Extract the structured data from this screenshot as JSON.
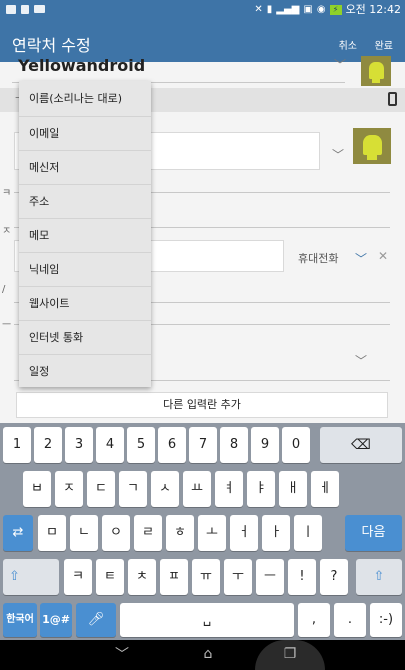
{
  "status_bar": {
    "time": "오전 12:42"
  },
  "app_bar": {
    "title": "연락처 수정",
    "cancel": "취소",
    "done": "완료"
  },
  "form": {
    "name_value": "Yellowandroid",
    "phone_type": "휴대전화",
    "add_field_button": "다른 입력란 추가"
  },
  "dropdown": {
    "items": [
      "이름(소리나는 대로)",
      "이메일",
      "메신저",
      "주소",
      "메모",
      "닉네임",
      "웹사이트",
      "인터넷 통화",
      "일정"
    ]
  },
  "keyboard": {
    "row1": [
      "1",
      "2",
      "3",
      "4",
      "5",
      "6",
      "7",
      "8",
      "9",
      "0"
    ],
    "row2": [
      "ㅂ",
      "ㅈ",
      "ㄷ",
      "ㄱ",
      "ㅅ",
      "ㅛ",
      "ㅕ",
      "ㅑ",
      "ㅐ",
      "ㅔ"
    ],
    "row3": [
      "ㅁ",
      "ㄴ",
      "ㅇ",
      "ㄹ",
      "ㅎ",
      "ㅗ",
      "ㅓ",
      "ㅏ",
      "ㅣ"
    ],
    "next": "다음",
    "row4": [
      "ㅋ",
      "ㅌ",
      "ㅊ",
      "ㅍ",
      "ㅠ",
      "ㅜ",
      "ㅡ",
      "!",
      "?"
    ],
    "lang": "한국어",
    "symbols": "1@#",
    "comma": ",",
    "period": ".",
    "smiley": ":-)"
  }
}
